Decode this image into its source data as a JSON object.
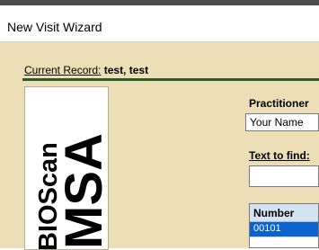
{
  "window": {
    "title": "New Visit Wizard"
  },
  "record": {
    "label": "Current Record:",
    "value": "test, test"
  },
  "logo": {
    "text_line1": "BIOScan",
    "text_line2": "MSA"
  },
  "form": {
    "practitioner_label": "Practitioner",
    "practitioner_value": "Your Name",
    "text_to_find_label": "Text to find:",
    "text_to_find_value": ""
  },
  "list": {
    "column_header": "Number",
    "rows": [
      "00101"
    ]
  },
  "colors": {
    "background": "#ecdfb7",
    "divider": "#2e5b28",
    "selection": "#0b63ce"
  }
}
